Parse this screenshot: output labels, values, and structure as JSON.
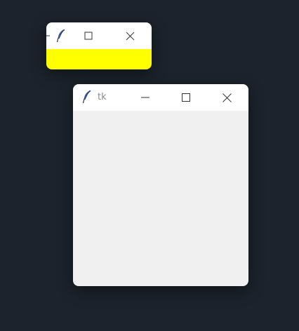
{
  "desktop": {
    "background_color": "#1c232c"
  },
  "small_window": {
    "title": "",
    "icon": "tk-feather-icon",
    "minimize_icon": "minimize-icon",
    "maximize_icon": "maximize-icon",
    "close_icon": "close-icon",
    "client_color": "#ffff00"
  },
  "tk_window": {
    "title": "tk",
    "icon": "tk-feather-icon",
    "minimize_icon": "minimize-icon",
    "maximize_icon": "maximize-icon",
    "close_icon": "close-icon",
    "client_color": "#f0f0f0"
  }
}
